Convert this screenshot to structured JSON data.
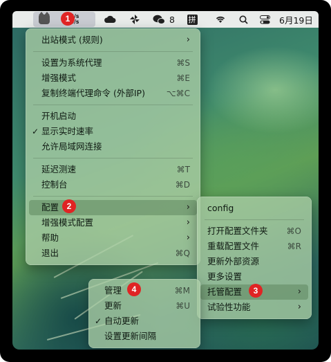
{
  "menubar": {
    "speed_up": "KB/s",
    "speed_down": "KB/s",
    "wechat_count": "8",
    "input_method": "拼",
    "clock": "6月19日"
  },
  "badges": [
    "1",
    "2",
    "3",
    "4"
  ],
  "main_menu": {
    "outbound_mode": "出站模式 (规则)",
    "set_system_proxy": "设置为系统代理",
    "set_system_proxy_sc": "⌘S",
    "enhanced_mode": "增强模式",
    "enhanced_mode_sc": "⌘E",
    "copy_terminal": "复制终端代理命令 (外部IP)",
    "copy_terminal_sc": "⌥⌘C",
    "launch_at_login": "开机启动",
    "show_speed": "显示实时速率",
    "allow_lan": "允许局域网连接",
    "latency_test": "延迟测速",
    "latency_test_sc": "⌘T",
    "dashboard": "控制台",
    "dashboard_sc": "⌘D",
    "config": "配置",
    "enhanced_config": "增强模式配置",
    "help": "帮助",
    "quit": "退出",
    "quit_sc": "⌘Q"
  },
  "config_menu": {
    "current": "config",
    "open_folder": "打开配置文件夹",
    "open_folder_sc": "⌘O",
    "reload": "重载配置文件",
    "reload_sc": "⌘R",
    "update_external": "更新外部资源",
    "more_settings": "更多设置",
    "managed_config": "托管配置",
    "experimental": "试验性功能"
  },
  "managed_menu": {
    "manage": "管理",
    "manage_sc": "⌘M",
    "update": "更新",
    "update_sc": "⌘U",
    "auto_update": "自动更新",
    "update_interval": "设置更新间隔"
  },
  "icons": {
    "check": "✓",
    "arrow": "›"
  }
}
